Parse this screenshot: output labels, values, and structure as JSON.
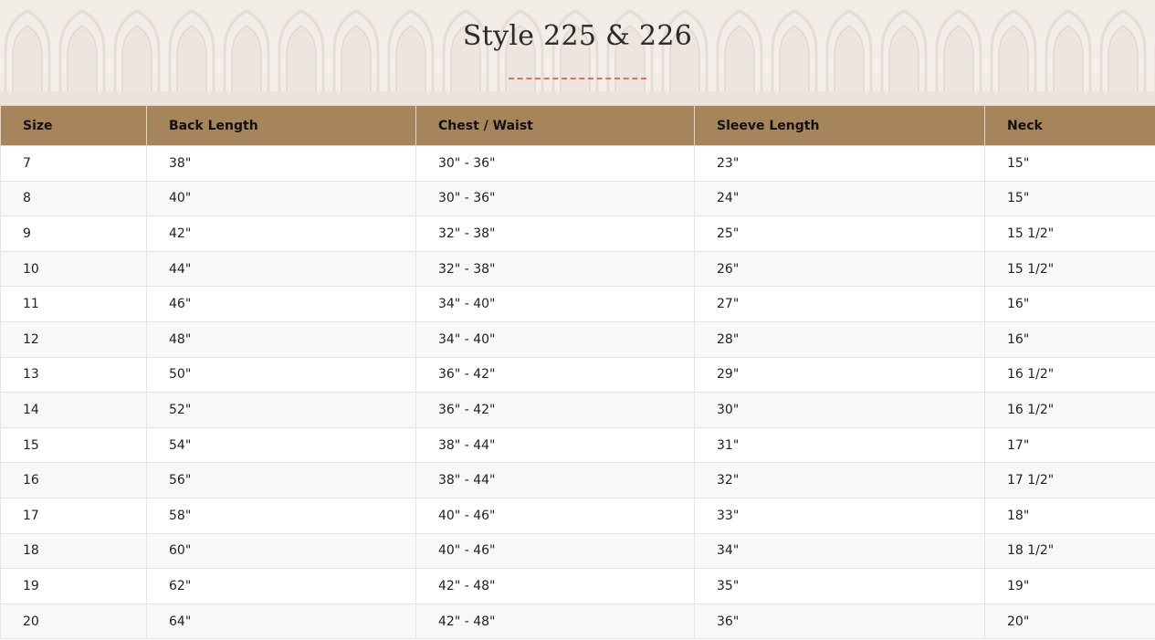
{
  "header": {
    "title": "Style 225 & 226"
  },
  "table": {
    "columns": [
      "Size",
      "Back Length",
      "Chest / Waist",
      "Sleeve Length",
      "Neck"
    ],
    "rows": [
      [
        "7",
        "38\"",
        "30\" - 36\"",
        "23\"",
        "15\""
      ],
      [
        "8",
        "40\"",
        "30\" - 36\"",
        "24\"",
        "15\""
      ],
      [
        "9",
        "42\"",
        "32\" - 38\"",
        "25\"",
        "15 1/2\""
      ],
      [
        "10",
        "44\"",
        "32\" - 38\"",
        "26\"",
        "15 1/2\""
      ],
      [
        "11",
        "46\"",
        "34\" - 40\"",
        "27\"",
        "16\""
      ],
      [
        "12",
        "48\"",
        "34\" - 40\"",
        "28\"",
        "16\""
      ],
      [
        "13",
        "50\"",
        "36\" - 42\"",
        "29\"",
        "16 1/2\""
      ],
      [
        "14",
        "52\"",
        "36\" - 42\"",
        "30\"",
        "16 1/2\""
      ],
      [
        "15",
        "54\"",
        "38\" - 44\"",
        "31\"",
        "17\""
      ],
      [
        "16",
        "56\"",
        "38\" - 44\"",
        "32\"",
        "17 1/2\""
      ],
      [
        "17",
        "58\"",
        "40\" - 46\"",
        "33\"",
        "18\""
      ],
      [
        "18",
        "60\"",
        "40\" - 46\"",
        "34\"",
        "18 1/2\""
      ],
      [
        "19",
        "62\"",
        "42\" - 48\"",
        "35\"",
        "19\""
      ],
      [
        "20",
        "64\"",
        "42\" - 48\"",
        "36\"",
        "20\""
      ]
    ]
  },
  "colors": {
    "header_bg": "#a6845c",
    "divider": "#d9706f",
    "row_alt": "#f8f8f8"
  }
}
